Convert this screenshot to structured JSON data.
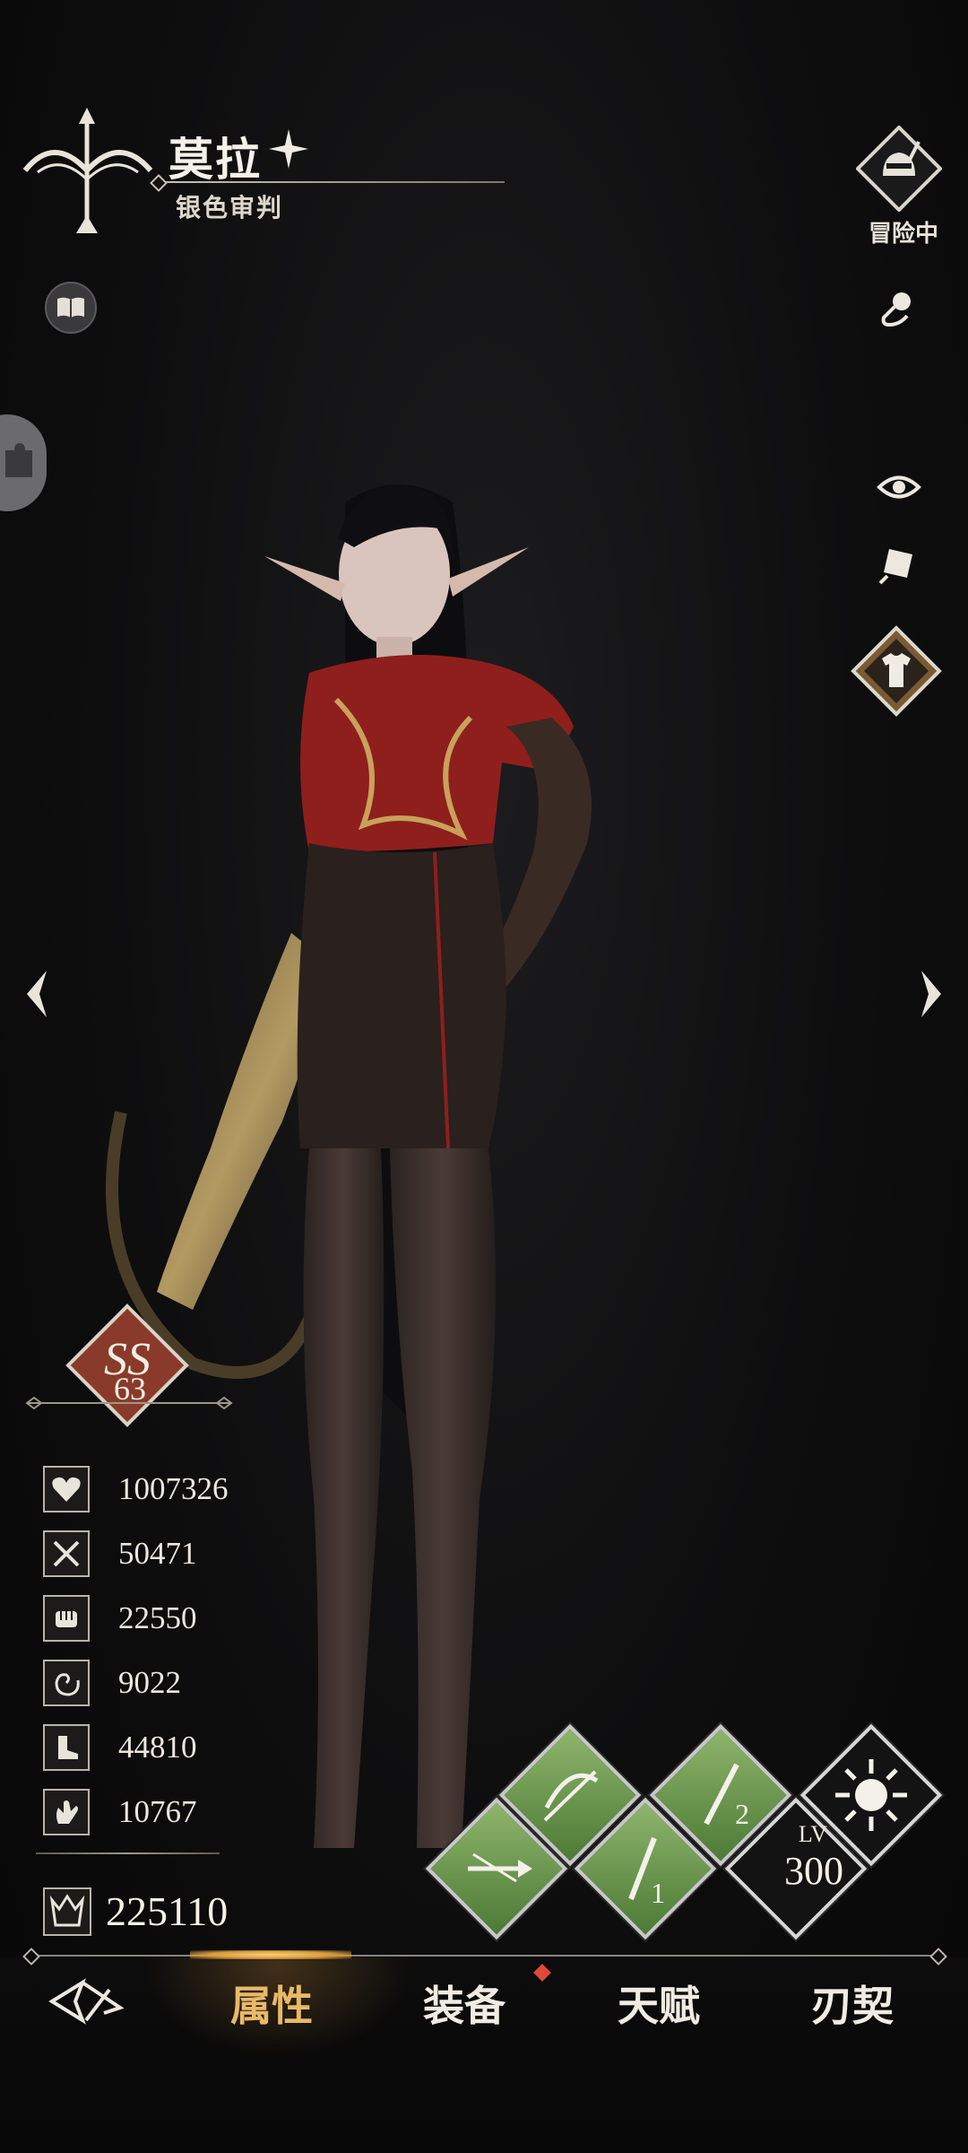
{
  "header": {
    "character_name": "莫拉",
    "character_title": "银色审判",
    "status_label": "冒险中"
  },
  "rank": {
    "grade": "SS",
    "level": "63"
  },
  "stats": [
    {
      "icon": "heart-icon",
      "value": "1007326"
    },
    {
      "icon": "crossed-swords-icon",
      "value": "50471"
    },
    {
      "icon": "fist-icon",
      "value": "22550"
    },
    {
      "icon": "swirl-icon",
      "value": "9022"
    },
    {
      "icon": "boot-icon",
      "value": "44810"
    },
    {
      "icon": "hand-icon",
      "value": "10767"
    }
  ],
  "combat_power": "225110",
  "skills": {
    "level_label": "LV",
    "level_value": "300",
    "skill_badges": [
      "2",
      "1"
    ]
  },
  "nav": {
    "tabs": [
      "属性",
      "装备",
      "天赋",
      "刃契"
    ],
    "active_index": 0
  },
  "colors": {
    "accent_gold": "#e8b968",
    "skill_green": "#6f9a50",
    "rank_red": "#8a3a2a",
    "notify_red": "#e0493a"
  }
}
